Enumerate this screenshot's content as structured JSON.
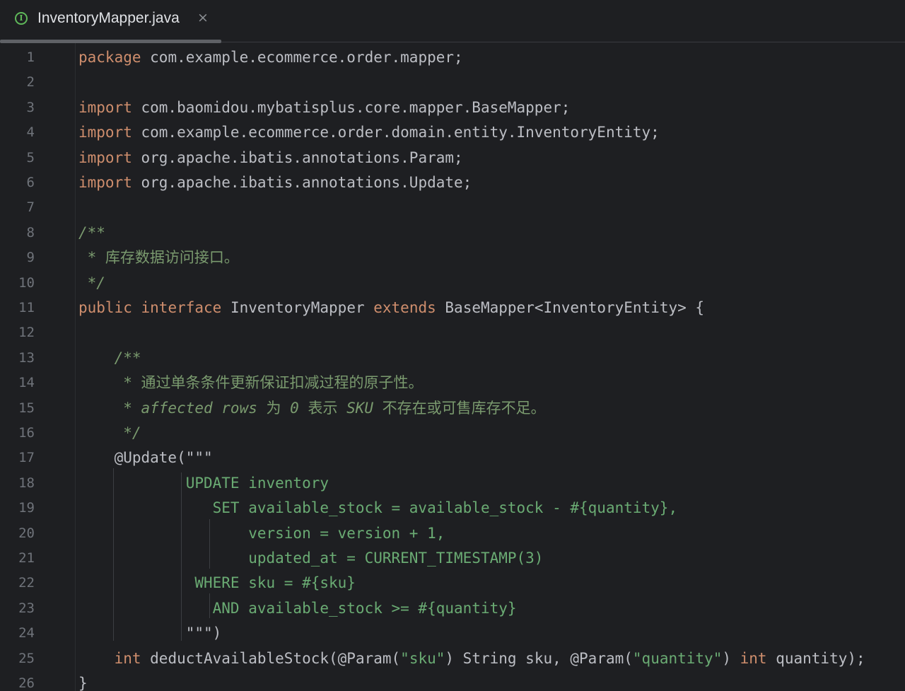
{
  "tab": {
    "icon_letter": "I",
    "title": "InventoryMapper.java",
    "close_glyph": "×"
  },
  "lines": [
    {
      "n": "1",
      "parts": [
        {
          "t": "package",
          "c": "kw"
        },
        {
          "t": " com.example.ecommerce.order.mapper;",
          "c": "plain"
        }
      ]
    },
    {
      "n": "2",
      "parts": []
    },
    {
      "n": "3",
      "parts": [
        {
          "t": "import",
          "c": "kw"
        },
        {
          "t": " com.baomidou.mybatisplus.core.mapper.BaseMapper;",
          "c": "plain"
        }
      ]
    },
    {
      "n": "4",
      "parts": [
        {
          "t": "import",
          "c": "kw"
        },
        {
          "t": " com.example.ecommerce.order.domain.entity.InventoryEntity;",
          "c": "plain"
        }
      ]
    },
    {
      "n": "5",
      "parts": [
        {
          "t": "import",
          "c": "kw"
        },
        {
          "t": " org.apache.ibatis.annotations.Param;",
          "c": "plain"
        }
      ]
    },
    {
      "n": "6",
      "parts": [
        {
          "t": "import",
          "c": "kw"
        },
        {
          "t": " org.apache.ibatis.annotations.Update;",
          "c": "plain"
        }
      ]
    },
    {
      "n": "7",
      "parts": []
    },
    {
      "n": "8",
      "parts": [
        {
          "t": "/**",
          "c": "cmi"
        }
      ]
    },
    {
      "n": "9",
      "parts": [
        {
          "t": " * 库存数据访问接口。",
          "c": "cm"
        }
      ]
    },
    {
      "n": "10",
      "parts": [
        {
          "t": " */",
          "c": "cmi"
        }
      ]
    },
    {
      "n": "11",
      "parts": [
        {
          "t": "public",
          "c": "kw"
        },
        {
          "t": " ",
          "c": "plain"
        },
        {
          "t": "interface",
          "c": "kw"
        },
        {
          "t": " InventoryMapper ",
          "c": "plain"
        },
        {
          "t": "extends",
          "c": "kw"
        },
        {
          "t": " BaseMapper<InventoryEntity> {",
          "c": "plain"
        }
      ]
    },
    {
      "n": "12",
      "parts": []
    },
    {
      "n": "13",
      "parts": [
        {
          "t": "    /**",
          "c": "cmi"
        }
      ]
    },
    {
      "n": "14",
      "parts": [
        {
          "t": "     * 通过单条条件更新保证扣减过程的原子性。",
          "c": "cm"
        }
      ]
    },
    {
      "n": "15",
      "parts": [
        {
          "t": "     * affected rows ",
          "c": "cmi"
        },
        {
          "t": "为",
          "c": "cm"
        },
        {
          "t": " 0 ",
          "c": "cmi"
        },
        {
          "t": "表示",
          "c": "cm"
        },
        {
          "t": " SKU ",
          "c": "cmi"
        },
        {
          "t": "不存在或可售库存不足。",
          "c": "cm"
        }
      ]
    },
    {
      "n": "16",
      "parts": [
        {
          "t": "     */",
          "c": "cmi"
        }
      ]
    },
    {
      "n": "17",
      "parts": [
        {
          "t": "    @Update(",
          "c": "plain"
        },
        {
          "t": "\"\"\"",
          "c": "plain"
        }
      ]
    },
    {
      "n": "18",
      "parts": [
        {
          "t": "            UPDATE inventory",
          "c": "sql"
        }
      ]
    },
    {
      "n": "19",
      "parts": [
        {
          "t": "               SET available_stock = available_stock - #{quantity},",
          "c": "sql"
        }
      ]
    },
    {
      "n": "20",
      "parts": [
        {
          "t": "                   version = version + 1,",
          "c": "sql"
        }
      ]
    },
    {
      "n": "21",
      "parts": [
        {
          "t": "                   updated_at = CURRENT_TIMESTAMP(3)",
          "c": "sql"
        }
      ]
    },
    {
      "n": "22",
      "parts": [
        {
          "t": "             WHERE sku = #{sku}",
          "c": "sql"
        }
      ]
    },
    {
      "n": "23",
      "parts": [
        {
          "t": "               AND available_stock >= #{quantity}",
          "c": "sql"
        }
      ]
    },
    {
      "n": "24",
      "parts": [
        {
          "t": "            \"\"\")",
          "c": "plain"
        }
      ]
    },
    {
      "n": "25",
      "parts": [
        {
          "t": "    ",
          "c": "plain"
        },
        {
          "t": "int",
          "c": "kw"
        },
        {
          "t": " deductAvailableStock(@Param(",
          "c": "plain"
        },
        {
          "t": "\"sku\"",
          "c": "str"
        },
        {
          "t": ") String sku, @Param(",
          "c": "plain"
        },
        {
          "t": "\"quantity\"",
          "c": "str"
        },
        {
          "t": ") ",
          "c": "plain"
        },
        {
          "t": "int",
          "c": "kw"
        },
        {
          "t": " quantity);",
          "c": "plain"
        }
      ]
    },
    {
      "n": "26",
      "parts": [
        {
          "t": "}",
          "c": "plain"
        }
      ]
    }
  ],
  "colors": {
    "background": "#1e1f22",
    "keyword": "#cf8e6d",
    "comment": "#7a9a6e",
    "string": "#6aab73",
    "text": "#bcbec4",
    "line_number": "#6f737a",
    "file_icon": "#5fb85a"
  }
}
